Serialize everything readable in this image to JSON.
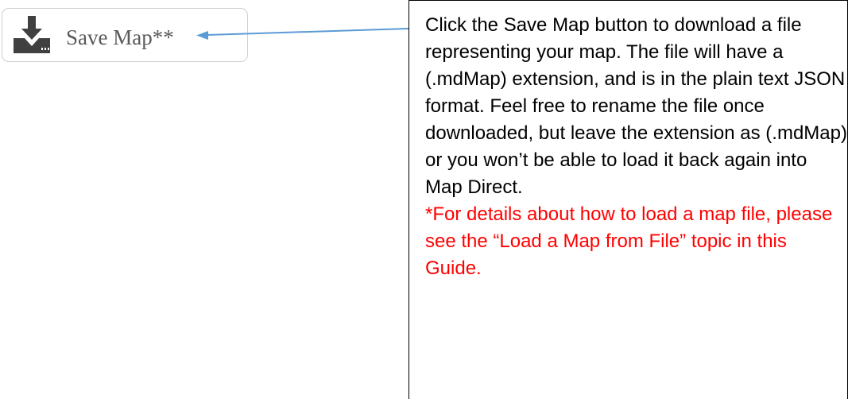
{
  "toolbar": {
    "save_map_label": "Save Map**",
    "icon": "download-drive-icon"
  },
  "callout": {
    "description": "Click the Save Map button to download a file representing your map. The file will have a (.mdMap) extension, and is in the plain text JSON format. Feel free to rename the file once downloaded, but leave the extension as (.mdMap) or you won’t be able to load it back again into Map Direct.",
    "note": "*For details about how to load a map file, please see the “Load a Map from File” topic in this Guide."
  },
  "colors": {
    "note_text": "#ff0000",
    "arrow": "#5b9bd5",
    "button_border": "#cfcfcf",
    "icon": "#404040"
  }
}
